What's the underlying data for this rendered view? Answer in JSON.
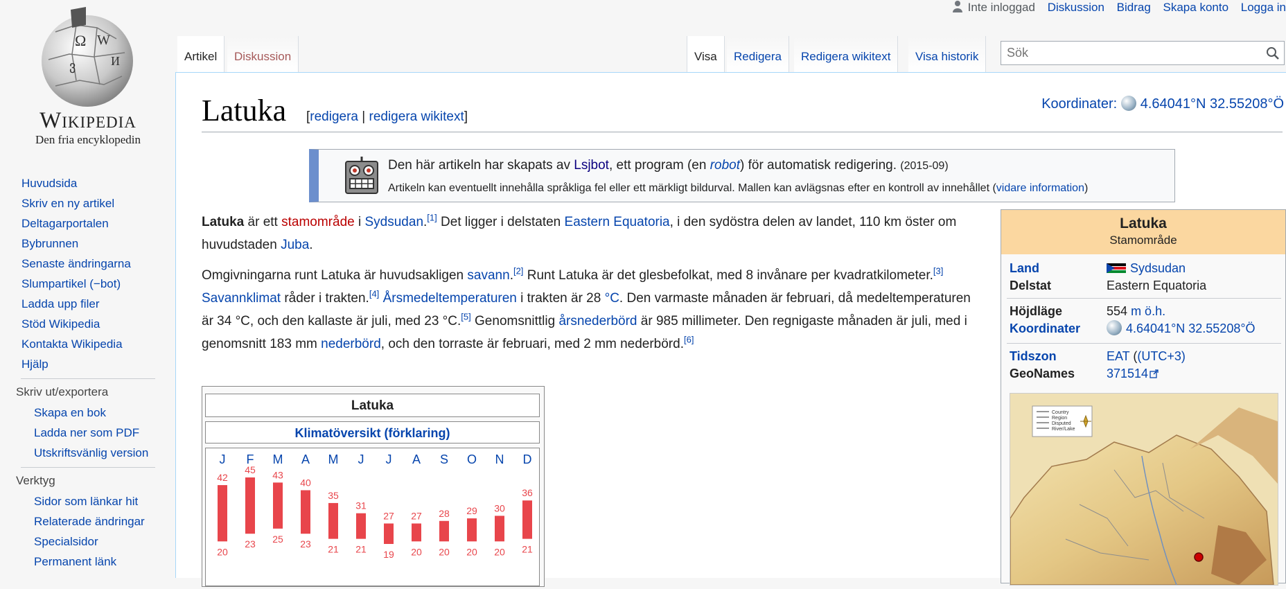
{
  "wordmark": {
    "title": "Wikipedia",
    "tagline": "Den fria encyklopedin"
  },
  "personal": {
    "not_logged_in": "Inte inloggad",
    "discussion": "Diskussion",
    "contributions": "Bidrag",
    "create_account": "Skapa konto",
    "login": "Logga in"
  },
  "tabs": {
    "article": "Artikel",
    "talk": "Diskussion",
    "read": "Visa",
    "edit": "Redigera",
    "edit_source": "Redigera wikitext",
    "history": "Visa historik"
  },
  "search": {
    "placeholder": "Sök"
  },
  "nav": {
    "main": [
      "Huvudsida",
      "Skriv en ny artikel",
      "Deltagarportalen",
      "Bybrunnen",
      "Senaste ändringarna",
      "Slumpartikel (−bot)",
      "Ladda upp filer",
      "Stöd Wikipedia",
      "Kontakta Wikipedia",
      "Hjälp"
    ],
    "print_heading": "Skriv ut/exportera",
    "print": [
      "Skapa en bok",
      "Ladda ner som PDF",
      "Utskriftsvänlig version"
    ],
    "tools_heading": "Verktyg",
    "tools": [
      "Sidor som länkar hit",
      "Relaterade ändringar",
      "Specialsidor",
      "Permanent länk"
    ]
  },
  "page": {
    "title": "Latuka",
    "edit": "redigera",
    "edit_source": "redigera wikitext",
    "coords_label": "Koordinater:",
    "coords": "4.64041°N 32.55208°Ö"
  },
  "notice": {
    "l1_a": "Den här artikeln har skapats av ",
    "l1_link": "Lsjbot",
    "l1_b": ", ett program (en ",
    "l1_robot": "robot",
    "l1_c": ") för automatisk redigering.",
    "l1_date": "(2015-09)",
    "l2": "Artikeln kan eventuellt innehålla språkliga fel eller ett märkligt bildurval. Mallen kan avlägsnas efter en kontroll av innehållet (",
    "l2_link": "vidare information",
    "l2_end": ")"
  },
  "para1": {
    "bold": "Latuka",
    "t1": " är ett ",
    "l1": "stamområde",
    "t2": " i ",
    "l2": "Sydsudan",
    "r1": "[1]",
    "t3": " Det ligger i delstaten ",
    "l3": "Eastern Equatoria",
    "t4": ", i den sydöstra delen av landet, 110 km öster om huvudstaden ",
    "l4": "Juba",
    "t5": "."
  },
  "para2": {
    "t1": "Omgivningarna runt Latuka är huvudsakligen ",
    "l1": "savann",
    "r2": "[2]",
    "t2": " Runt Latuka är det glesbefolkat, med 8 invånare per kvadratkilometer.",
    "r3": "[3]",
    "l2": "Savannklimat",
    "t3": " råder i trakten.",
    "r4": "[4]",
    "l3": "Årsmedeltemperaturen",
    "t4": " i trakten är 28 ",
    "l4": "°C",
    "t5": ". Den varmaste månaden är februari, då medeltemperaturen är 34 °C, och den kallaste är juli, med 23 °C.",
    "r5": "[5]",
    "t6": " Genomsnittlig ",
    "l5": "årsnederbörd",
    "t7": " är 985 millimeter. Den regnigaste månaden är juli, med i genomsnitt 183 mm ",
    "l6": "nederbörd",
    "t8": ", och den torraste är februari, med 2 mm nederbörd.",
    "r6": "[6]"
  },
  "climate": {
    "title": "Latuka",
    "overview": "Klimatöversikt",
    "explain": "förklaring",
    "colors": {
      "bar": "#e8454b",
      "month": "#0645ad"
    }
  },
  "chart_data": {
    "type": "bar",
    "title": "Latuka",
    "categories": [
      "J",
      "F",
      "M",
      "A",
      "M",
      "J",
      "J",
      "A",
      "S",
      "O",
      "N",
      "D"
    ],
    "series": [
      {
        "values": [
          42,
          45,
          43,
          40,
          35,
          31,
          27,
          27,
          28,
          29,
          30,
          36
        ]
      },
      {
        "values": [
          20,
          23,
          25,
          23,
          21,
          21,
          19,
          20,
          20,
          20,
          20,
          21
        ]
      }
    ]
  },
  "infobox": {
    "title": "Latuka",
    "subtitle": "Stamområde",
    "land_k": "Land",
    "land_v": "Sydsudan",
    "state_k": "Delstat",
    "state_v": "Eastern Equatoria",
    "elev_k": "Höjdläge",
    "elev_v": "554",
    "elev_unit": "m ö.h.",
    "coord_k": "Koordinater",
    "coord_v": "4.64041°N 32.55208°Ö",
    "tz_k": "Tidszon",
    "tz_v": "EAT",
    "tz_paren": "(UTC+3)",
    "geo_k": "GeoNames",
    "geo_v": "371514",
    "legend": [
      "Country",
      "Region",
      "Disputed",
      "River/Lake"
    ]
  }
}
